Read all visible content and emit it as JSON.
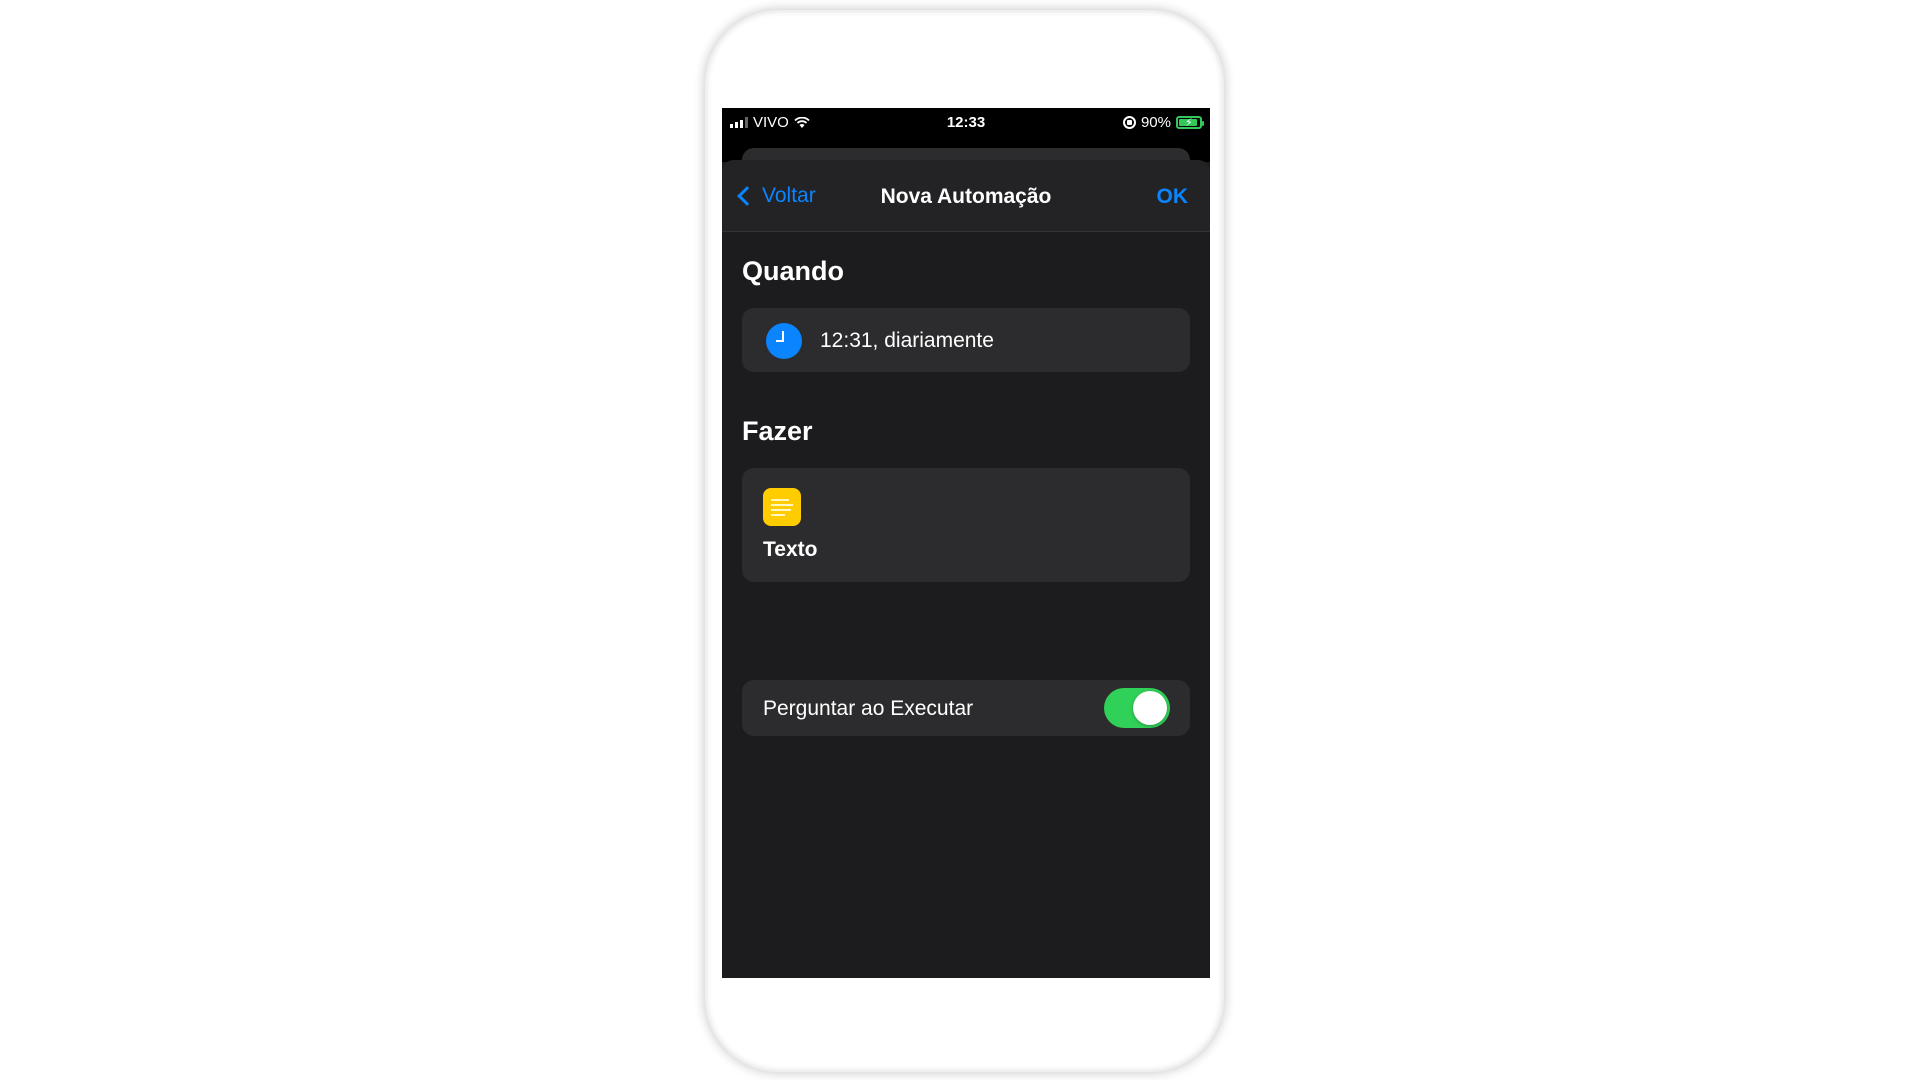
{
  "status_bar": {
    "carrier": "VIVO",
    "time": "12:33",
    "battery": "90%",
    "battery_level": 0.9
  },
  "nav": {
    "back_label": "Voltar",
    "title": "Nova Automação",
    "done_label": "OK"
  },
  "when": {
    "section_title": "Quando",
    "trigger_text": "12:31, diariamente",
    "icon": "clock-icon"
  },
  "do": {
    "section_title": "Fazer",
    "action_label": "Texto",
    "icon": "text-note-icon"
  },
  "ask_before_running": {
    "label": "Perguntar ao Executar",
    "enabled": true
  },
  "colors": {
    "accent": "#0a84ff",
    "toggle_on": "#30d158",
    "note_icon": "#ffcc00",
    "background": "#1c1c1e",
    "card": "#2c2c2e"
  }
}
